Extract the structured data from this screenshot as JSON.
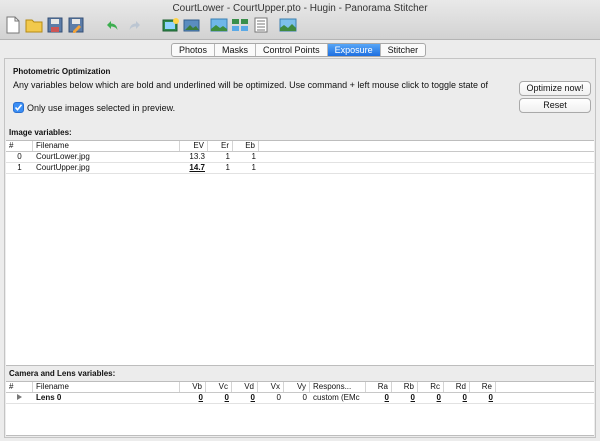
{
  "window": {
    "title": "CourtLower - CourtUpper.pto - Hugin - Panorama Stitcher"
  },
  "toolbar": {
    "icons": [
      "new-file-icon",
      "open-folder-icon",
      "save-icon",
      "save-as-icon",
      "undo-icon",
      "redo-icon",
      "fast-preview-icon",
      "preview-icon",
      "assistant-icon",
      "stitch-layout-icon",
      "list-icon",
      "stitcher-icon"
    ]
  },
  "tabs": [
    {
      "label": "Photos",
      "active": false
    },
    {
      "label": "Masks",
      "active": false
    },
    {
      "label": "Control Points",
      "active": false
    },
    {
      "label": "Exposure",
      "active": true
    },
    {
      "label": "Stitcher",
      "active": false
    }
  ],
  "photometric": {
    "heading": "Photometric Optimization",
    "description": "Any variables below which are bold and underlined will be optimized. Use command + left mouse click to toggle state of",
    "optimize_label": "Optimize now!",
    "reset_label": "Reset",
    "checkbox_label": "Only use images selected in preview.",
    "checkbox_checked": true
  },
  "image_vars": {
    "heading": "Image variables:",
    "columns": [
      "#",
      "Filename",
      "EV",
      "Er",
      "Eb"
    ],
    "rows": [
      {
        "idx": "0",
        "filename": "CourtLower.jpg",
        "ev": "13.3",
        "er": "1",
        "eb": "1"
      },
      {
        "idx": "1",
        "filename": "CourtUpper.jpg",
        "ev": "14.7",
        "er": "1",
        "eb": "1"
      }
    ]
  },
  "lens_vars": {
    "heading": "Camera and Lens variables:",
    "columns": [
      "#",
      "Filename",
      "Vb",
      "Vc",
      "Vd",
      "Vx",
      "Vy",
      "Respons...",
      "Ra",
      "Rb",
      "Rc",
      "Rd",
      "Re"
    ],
    "rows": [
      {
        "name": "Lens 0",
        "vb": "0",
        "vc": "0",
        "vd": "0",
        "vx": "0",
        "vy": "0",
        "resp": "custom (EMc",
        "ra": "0",
        "rb": "0",
        "rc": "0",
        "rd": "0",
        "re": "0"
      }
    ]
  },
  "colors": {
    "accent": "#2f80ed",
    "window_bg": "#ececec",
    "grid_bg": "#ffffff"
  }
}
